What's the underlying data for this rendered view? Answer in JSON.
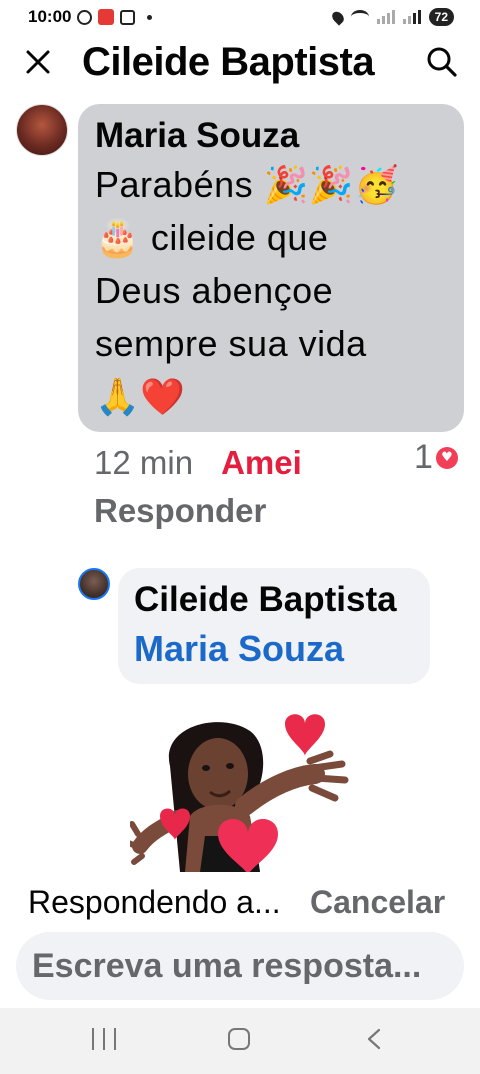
{
  "status_bar": {
    "time": "10:00",
    "battery": "72"
  },
  "header": {
    "title": "Cileide Baptista"
  },
  "comment": {
    "author": "Maria Souza",
    "lines": [
      "Parabéns 🎉🎉🥳",
      "🎂 cileide que",
      "Deus abençoe",
      "sempre sua vida",
      "🙏❤️"
    ],
    "time": "12 min",
    "reaction_label": "Amei",
    "reaction_count": "1",
    "reply_label": "Responder"
  },
  "reply": {
    "author": "Cileide Baptista",
    "mention": "Maria Souza"
  },
  "composer": {
    "replying_to": "Respondendo a...",
    "cancel": "Cancelar",
    "placeholder": "Escreva uma resposta..."
  },
  "colors": {
    "reaction_red": "#e41e3f",
    "mention_blue": "#1b6ac9",
    "bubble_gray": "#cfd0d4",
    "muted_text": "#65676b"
  },
  "icons": {
    "close": "close-icon",
    "search": "search-icon",
    "heart": "heart-icon"
  }
}
